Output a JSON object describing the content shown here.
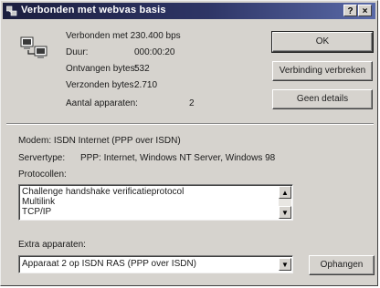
{
  "window": {
    "title": "Verbonden met webvas basis",
    "help_button": "?",
    "close_button": "×"
  },
  "status": {
    "connected_label": "Verbonden met 230.400 bps",
    "duration_label": "Duur:",
    "duration_value": "000:00:20",
    "received_label": "Ontvangen bytes:",
    "received_value": "532",
    "sent_label": "Verzonden bytes:",
    "sent_value": "2.710",
    "devices_label": "Aantal apparaten:",
    "devices_value": "2"
  },
  "buttons": {
    "ok": "OK",
    "disconnect": "Verbinding verbreken",
    "no_details": "Geen details",
    "hangup": "Ophangen"
  },
  "details": {
    "modem": "Modem: ISDN Internet (PPP over ISDN)",
    "server_type_label": "Servertype:",
    "server_type_value": "PPP: Internet, Windows NT Server, Windows 98",
    "protocols_label": "Protocollen:",
    "protocols": [
      "Challenge handshake verificatieprotocol",
      "Multilink",
      "TCP/IP"
    ],
    "extra_devices_label": "Extra apparaten:",
    "extra_devices_value": "Apparaat 2 op ISDN RAS (PPP over ISDN)"
  }
}
